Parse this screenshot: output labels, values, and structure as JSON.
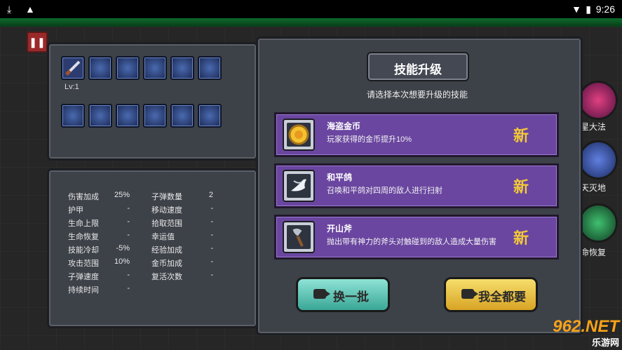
{
  "status_bar": {
    "time": "9:26",
    "icons": [
      "download-icon",
      "warning-icon",
      "wifi-icon",
      "battery-icon"
    ]
  },
  "equipment": {
    "weapon_level": "Lv:1"
  },
  "stats": {
    "left": [
      {
        "label": "伤害加成",
        "value": "25%"
      },
      {
        "label": "护甲",
        "value": "-"
      },
      {
        "label": "生命上限",
        "value": "-"
      },
      {
        "label": "生命恢复",
        "value": "-"
      },
      {
        "label": "技能冷却",
        "value": "-5%"
      },
      {
        "label": "攻击范围",
        "value": "10%"
      },
      {
        "label": "子弹速度",
        "value": "-"
      },
      {
        "label": "持续时间",
        "value": "-"
      }
    ],
    "right": [
      {
        "label": "子弹数量",
        "value": "2"
      },
      {
        "label": "移动速度",
        "value": "-"
      },
      {
        "label": "拾取范围",
        "value": "-"
      },
      {
        "label": "幸运值",
        "value": "-"
      },
      {
        "label": "经验加成",
        "value": "-"
      },
      {
        "label": "金币加成",
        "value": "-"
      },
      {
        "label": "复活次数",
        "value": "-"
      }
    ]
  },
  "skill_upgrade": {
    "title": "技能升级",
    "subtitle": "请选择本次想要升级的技能",
    "options": [
      {
        "name": "海盗金币",
        "desc": "玩家获得的金币提升10%",
        "badge": "新",
        "icon": "gold-coin-icon"
      },
      {
        "name": "和平鸽",
        "desc": "召唤和平鸽对四周的敌人进行扫射",
        "badge": "新",
        "icon": "dove-icon"
      },
      {
        "name": "开山斧",
        "desc": "抛出带有神力的斧头对触碰到的敌人造成大量伤害",
        "badge": "新",
        "icon": "axe-icon"
      }
    ],
    "refresh_label": "换一批",
    "take_all_label": "我全都要"
  },
  "side_skills": [
    {
      "label": "星大法",
      "icon": "vortex-icon"
    },
    {
      "label": "天灭地",
      "icon": "meteor-icon"
    },
    {
      "label": "命恢复",
      "icon": "heal-icon"
    }
  ],
  "watermark": {
    "top": "962.NET",
    "bottom": "乐游网"
  },
  "colors": {
    "card": "#6a46a0",
    "badge": "#f2c838",
    "refresh": "#5cc4b4",
    "take_all": "#e8c048"
  }
}
